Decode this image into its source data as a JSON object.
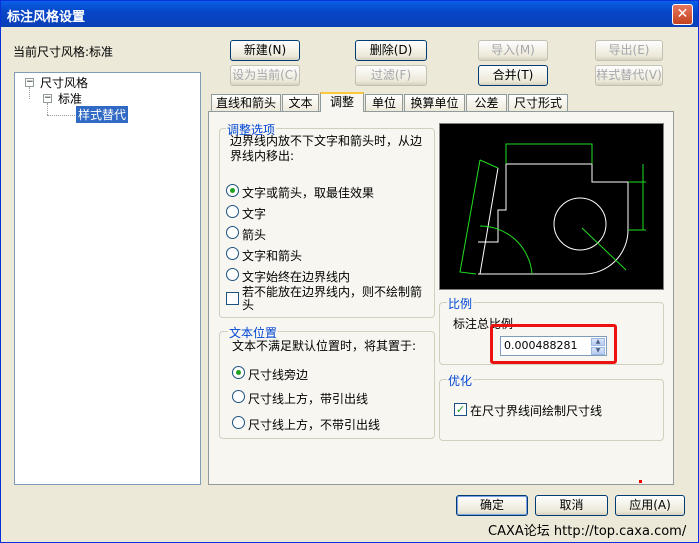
{
  "window": {
    "title": "标注风格设置",
    "close_glyph": "✕"
  },
  "current_style_label": "当前尺寸风格:标准",
  "buttons": {
    "new": "新建(N)",
    "delete": "删除(D)",
    "import": "导入(M)",
    "export": "导出(E)",
    "set_current": "设为当前(C)",
    "filter": "过滤(F)",
    "merge": "合并(T)",
    "style_override": "样式替代(V)"
  },
  "tree": {
    "root": "尺寸风格",
    "child": "标准",
    "grandchild": "样式替代",
    "expand_glyph": "−"
  },
  "tabs": [
    "直线和箭头",
    "文本",
    "调整",
    "单位",
    "换算单位",
    "公差",
    "尺寸形式"
  ],
  "active_tab": "调整",
  "adjust_options": {
    "title": "调整选项",
    "description": "边界线内放不下文字和箭头时，从边界线内移出:",
    "options": [
      "文字或箭头，取最佳效果",
      "文字",
      "箭头",
      "文字和箭头",
      "文字始终在边界线内"
    ],
    "selected_index": 0,
    "checkbox_label": "若不能放在边界线内，则不绘制箭头",
    "checkbox_checked": false
  },
  "text_position": {
    "title": "文本位置",
    "description": "文本不满足默认位置时，将其置于:",
    "options": [
      "尺寸线旁边",
      "尺寸线上方，带引出线",
      "尺寸线上方，不带引出线"
    ],
    "selected_index": 0
  },
  "scale": {
    "title": "比例",
    "label": "标注总比例",
    "value": "0.000488281"
  },
  "optimize": {
    "title": "优化",
    "checkbox_label": "在尺寸界线间绘制尺寸线",
    "checked": true,
    "check_glyph": "✓"
  },
  "footer": {
    "ok": "确定",
    "cancel": "取消",
    "apply": "应用(A)",
    "watermark": "CAXA论坛 http://top.caxa.com/"
  },
  "colors": {
    "preview_bg": "#000000",
    "preview_lines": "#ffffff",
    "preview_dims": "#22dd22",
    "highlight_red": "#ee1111"
  }
}
